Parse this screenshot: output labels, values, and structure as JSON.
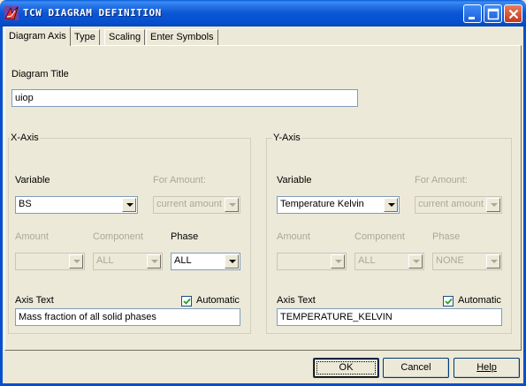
{
  "window": {
    "title": "TCW DIAGRAM DEFINITION"
  },
  "tabs": [
    {
      "label": "Diagram Axis"
    },
    {
      "label": "Type"
    },
    {
      "label": "Scaling"
    },
    {
      "label": "Enter Symbols"
    }
  ],
  "diagram": {
    "title_label": "Diagram Title",
    "title_value": "uiop"
  },
  "x_axis": {
    "group_label": "X-Axis",
    "variable_label": "Variable",
    "variable_value": "BS",
    "for_amount_label": "For Amount:",
    "for_amount_value": "current amount",
    "amount_label": "Amount",
    "amount_value": "",
    "component_label": "Component",
    "component_value": "ALL",
    "phase_label": "Phase",
    "phase_value": "ALL",
    "axis_text_label": "Axis Text",
    "automatic_label": "Automatic",
    "automatic_checked": true,
    "axis_text_value": "Mass fraction of all solid phases"
  },
  "y_axis": {
    "group_label": "Y-Axis",
    "variable_label": "Variable",
    "variable_value": "Temperature Kelvin",
    "for_amount_label": "For Amount:",
    "for_amount_value": "current amount",
    "amount_label": "Amount",
    "amount_value": "",
    "component_label": "Component",
    "component_value": "ALL",
    "phase_label": "Phase",
    "phase_value": "NONE",
    "axis_text_label": "Axis Text",
    "automatic_label": "Automatic",
    "automatic_checked": true,
    "axis_text_value": "TEMPERATURE_KELVIN"
  },
  "buttons": {
    "ok": "OK",
    "cancel": "Cancel",
    "help": "Help"
  }
}
